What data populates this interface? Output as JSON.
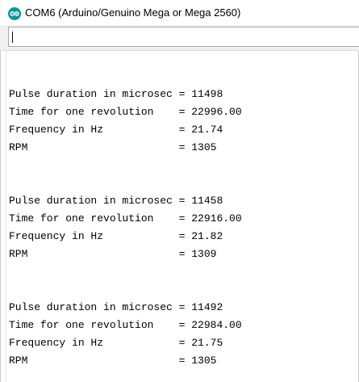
{
  "window": {
    "title": "COM6 (Arduino/Genuino Mega or Mega 2560)",
    "icon": "arduino-logo-icon"
  },
  "send_input": {
    "value": ""
  },
  "console": {
    "lines": [
      "Pulse duration in microsec = 11498",
      "Time for one revolution    = 22996.00",
      "Frequency in Hz            = 21.74",
      "RPM                        = 1305",
      "Pulse duration in microsec = 11458",
      "Time for one revolution    = 22916.00",
      "Frequency in Hz            = 21.82",
      "RPM                        = 1309",
      "Pulse duration in microsec = 11492",
      "Time for one revolution    = 22984.00",
      "Frequency in Hz            = 21.75",
      "RPM                        = 1305"
    ]
  },
  "colors": {
    "arduino_teal": "#00979c"
  }
}
